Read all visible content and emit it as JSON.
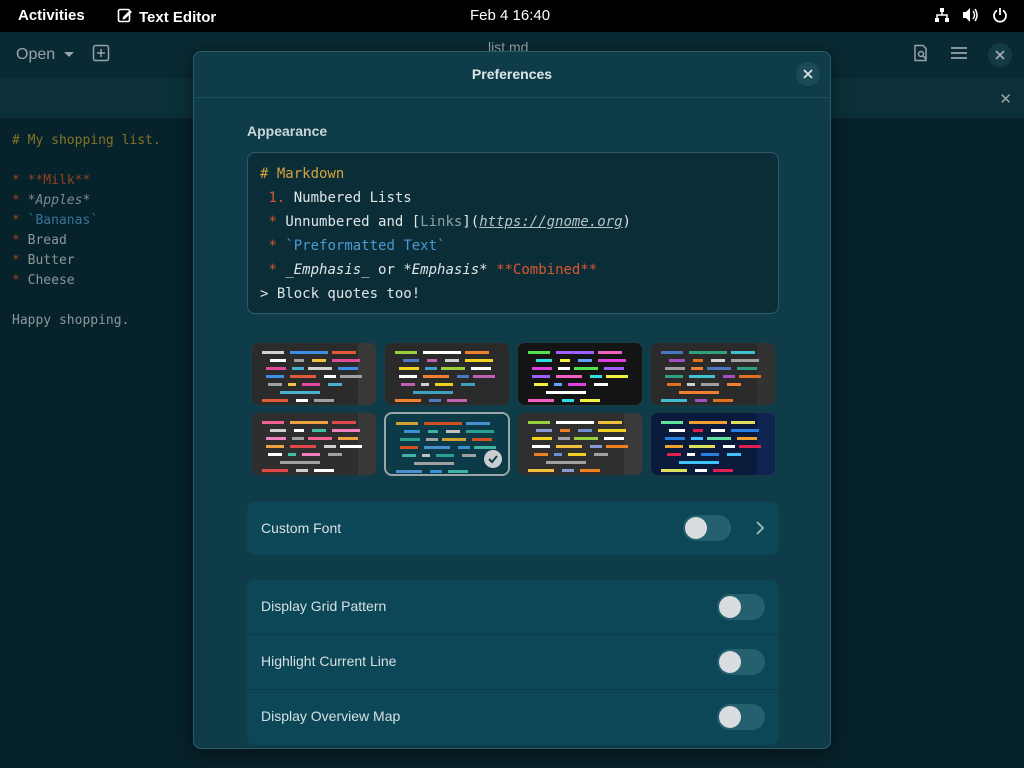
{
  "topbar": {
    "activities": "Activities",
    "app_name": "Text Editor",
    "clock": "Feb 4  16:40",
    "icons": [
      "network-icon",
      "volume-icon",
      "power-icon"
    ]
  },
  "editor": {
    "open_label": "Open",
    "doc_title": "list.md",
    "lines": [
      "# My shopping list.",
      "",
      "* **Milk**",
      "* *Apples*",
      "* `Bananas`",
      "* Bread",
      "* Butter",
      "* Cheese",
      "",
      "Happy shopping."
    ]
  },
  "dialog": {
    "title": "Preferences",
    "section_appearance": "Appearance",
    "preview": {
      "line1": "# Markdown",
      "line2_num": "1.",
      "line2_text": "Numbered Lists",
      "line3_bullet": "*",
      "line3_text": "Unnumbered and ",
      "line3_link_open": "[",
      "line3_link": "Links",
      "line3_link_close": "](",
      "line3_url": "https://gnome.org",
      "line3_paren": ")",
      "line4_bullet": "*",
      "line4_code": "`Preformatted Text`",
      "line5_bullet": "*",
      "line5_ital1": "_Emphasis_",
      "line5_or": " or ",
      "line5_ital2": "*Emphasis*",
      "line5_bold": "**Combined**",
      "line6": "> Block quotes too!"
    },
    "schemes_selected_index": 5,
    "rows": {
      "custom_font": "Custom Font",
      "grid": "Display Grid Pattern",
      "highlight": "Highlight Current Line",
      "overview": "Display Overview Map"
    },
    "toggles": {
      "custom_font": false,
      "grid": false,
      "highlight": false,
      "overview": false
    }
  },
  "colors": {
    "accent": "#0b4756",
    "bullet": "#d9582f",
    "heading": "#d6a23a",
    "code": "#4c9ad0"
  }
}
